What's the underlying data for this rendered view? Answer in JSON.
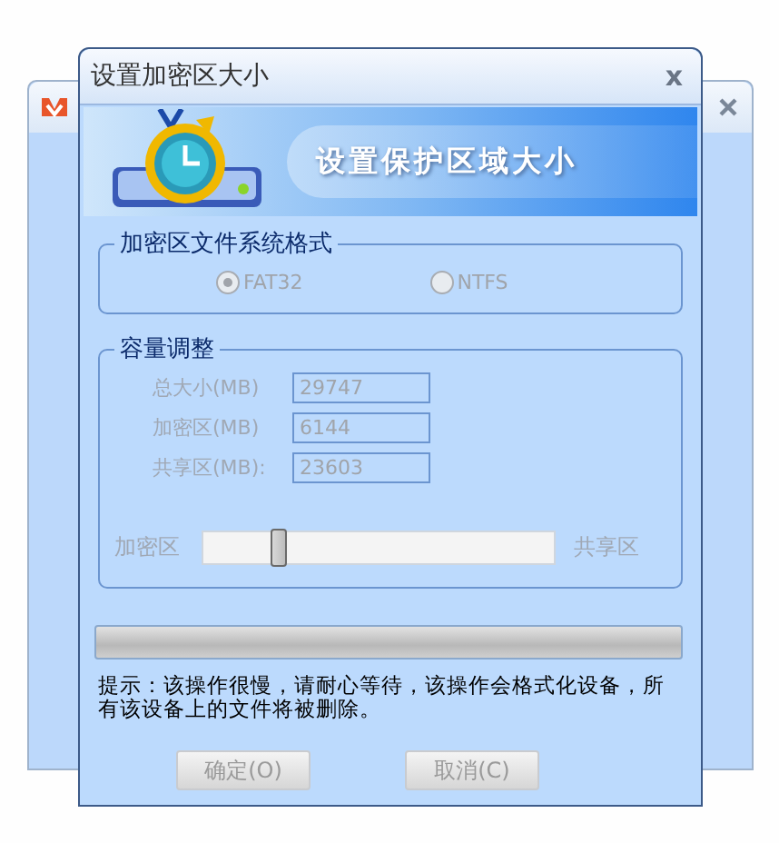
{
  "dialog": {
    "title": "设置加密区大小",
    "close": "x",
    "banner": "设置保护区域大小",
    "format_group": {
      "title": "加密区文件系统格式",
      "options": [
        {
          "label": "FAT32",
          "selected": true,
          "disabled": true
        },
        {
          "label": "NTFS",
          "selected": false,
          "disabled": true
        }
      ]
    },
    "capacity_group": {
      "title": "容量调整",
      "fields": [
        {
          "label": "总大小(MB)",
          "value": "29747",
          "disabled": true
        },
        {
          "label": "加密区(MB)",
          "value": "6144",
          "disabled": true
        },
        {
          "label": "共享区(MB):",
          "value": "23603",
          "disabled": true
        }
      ],
      "slider": {
        "left_label": "加密区",
        "right_label": "共享区",
        "level": 0.22,
        "disabled": true
      }
    },
    "progress": {
      "level": 0
    },
    "hint": "提示：该操作很慢，请耐心等待，该操作会格式化设备，所有该设备上的文件将被删除。",
    "buttons": [
      {
        "label": "确定(O)",
        "disabled": true
      },
      {
        "label": "取消(C)",
        "disabled": true
      }
    ]
  }
}
